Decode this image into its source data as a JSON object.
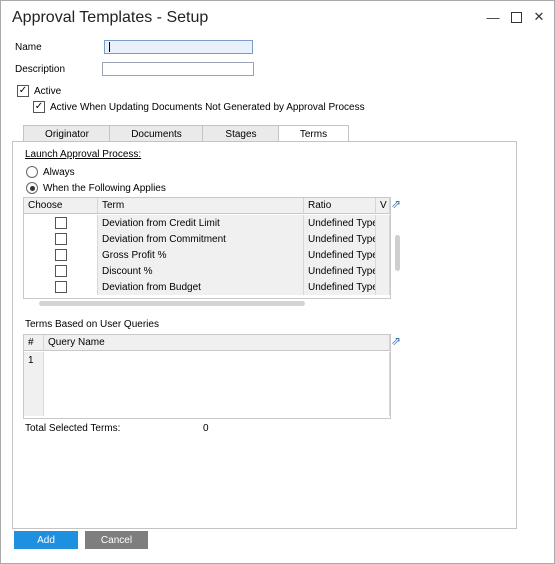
{
  "window": {
    "title": "Approval Templates - Setup",
    "min_icon": "minimize-icon",
    "max_icon": "maximize-icon",
    "close_icon": "close-icon"
  },
  "form": {
    "name_label": "Name",
    "name_value": "",
    "description_label": "Description",
    "description_value": "",
    "active_label": "Active",
    "active_checked": true,
    "active_updating_label": "Active When Updating Documents Not Generated by Approval Process",
    "active_updating_checked": true
  },
  "tabs": [
    {
      "label": "Originator"
    },
    {
      "label": "Documents"
    },
    {
      "label": "Stages"
    },
    {
      "label": "Terms",
      "active": true
    }
  ],
  "terms": {
    "launch_label": "Launch Approval Process:",
    "always_label": "Always",
    "when_label": "When the Following Applies",
    "selected": "when",
    "columns": [
      "Choose",
      "Term",
      "Ratio",
      "V"
    ],
    "rows": [
      {
        "term": "Deviation from Credit Limit",
        "ratio": "Undefined Type",
        "checked": false
      },
      {
        "term": "Deviation from Commitment",
        "ratio": "Undefined Type",
        "checked": false
      },
      {
        "term": "Gross Profit %",
        "ratio": "Undefined Type",
        "checked": false
      },
      {
        "term": "Discount %",
        "ratio": "Undefined Type",
        "checked": false
      },
      {
        "term": "Deviation from Budget",
        "ratio": "Undefined Type",
        "checked": false
      }
    ],
    "queries_label": "Terms Based on User Queries",
    "query_columns": [
      "#",
      "Query Name"
    ],
    "query_rows": [
      {
        "num": "1",
        "name": ""
      },
      {
        "num": "",
        "name": ""
      },
      {
        "num": "",
        "name": ""
      },
      {
        "num": "",
        "name": ""
      }
    ],
    "total_label": "Total Selected Terms:",
    "total_value": "0"
  },
  "buttons": {
    "add_label": "Add",
    "cancel_label": "Cancel"
  },
  "colors": {
    "add_bg": "#1f8fe0",
    "cancel_bg": "#7e7e7e"
  }
}
